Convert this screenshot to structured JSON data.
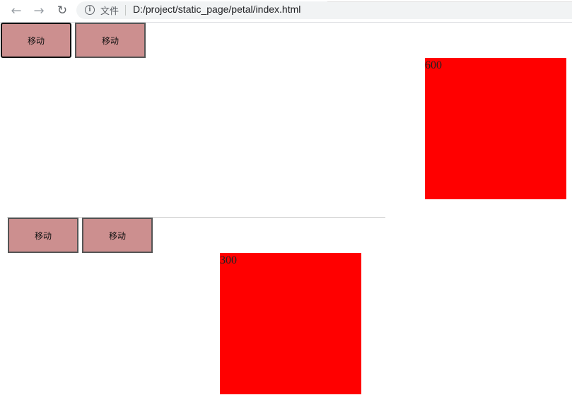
{
  "browser": {
    "file_label": "文件",
    "url": "D:/project/static_page/petal/index.html"
  },
  "section1": {
    "buttons": [
      "移动",
      "移动"
    ],
    "box_value": "600"
  },
  "section2": {
    "buttons": [
      "移动",
      "移动"
    ],
    "box_value": "300"
  },
  "colors": {
    "box": "#ff0000",
    "button": "#cc8f8f"
  }
}
